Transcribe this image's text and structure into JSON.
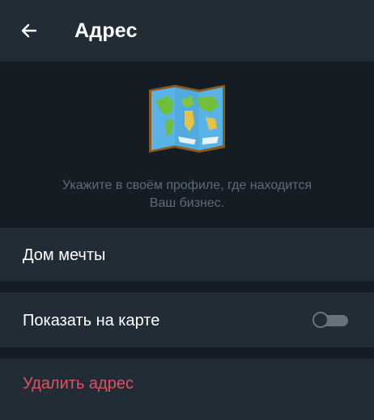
{
  "header": {
    "title": "Адрес",
    "back_icon": "arrow-left-icon"
  },
  "hero": {
    "icon": "world-map-icon",
    "hint": "Укажите в своём профиле, где находится Ваш бизнес."
  },
  "address": {
    "value": "Дом мечты"
  },
  "show_on_map": {
    "label": "Показать на карте",
    "enabled": false
  },
  "delete": {
    "label": "Удалить адрес"
  },
  "colors": {
    "background": "#151c24",
    "surface": "#222c36",
    "text": "#ffffff",
    "hint": "#5d6b78",
    "danger": "#e0535c",
    "toggle_off": "#69727c"
  }
}
